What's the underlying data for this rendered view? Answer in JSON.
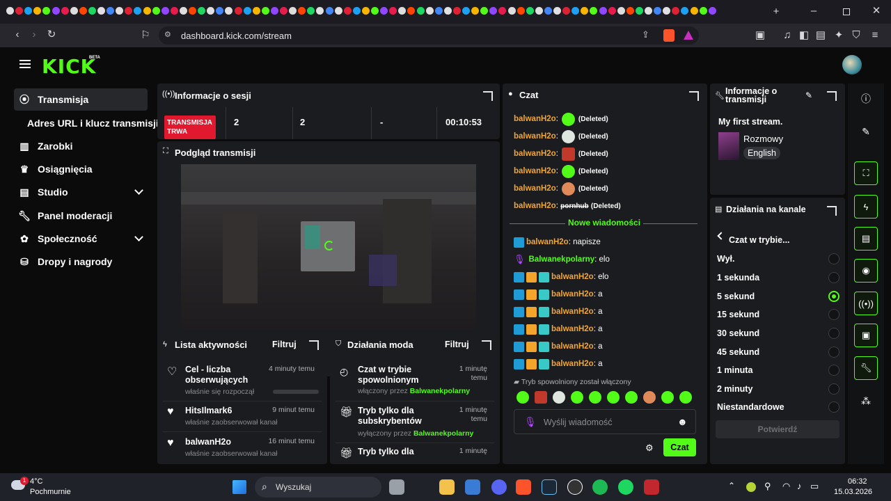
{
  "browser": {
    "url": "dashboard.kick.com/stream",
    "window_controls": [
      "minimize-icon",
      "maximize-icon",
      "close-icon"
    ]
  },
  "app": {
    "logo": "KICK",
    "logo_badge": "BETA",
    "accent": "#53fc18"
  },
  "sidebar": {
    "items": [
      {
        "label": "Transmisja",
        "icon": "broadcast-icon"
      },
      {
        "label": "Adres URL i klucz transmisji",
        "icon": ""
      },
      {
        "label": "Zarobki",
        "icon": "chart-icon"
      },
      {
        "label": "Osiągnięcia",
        "icon": "trophy-icon"
      },
      {
        "label": "Studio",
        "icon": "studio-icon"
      },
      {
        "label": "Panel moderacji",
        "icon": "wrench-icon"
      },
      {
        "label": "Społeczność",
        "icon": "community-icon"
      },
      {
        "label": "Dropy i nagrody",
        "icon": "drops-icon"
      }
    ]
  },
  "session": {
    "title": "Informacje o sesji",
    "live_badge_line1": "TRANSMISJA",
    "live_badge_line2": "TRWA",
    "stats": [
      "2",
      "2",
      "-",
      "00:10:53"
    ]
  },
  "preview": {
    "title": "Podgląd transmisji"
  },
  "activity": {
    "title": "Lista aktywności",
    "filter": "Filtruj",
    "rows": [
      {
        "title": "Cel - liczba obserwujących",
        "sub": "właśnie się rozpoczął",
        "time": "4 minuty temu"
      },
      {
        "title": "HitsIlmark6",
        "sub": "właśnie zaobserwował kanał",
        "time": "9 minut temu"
      },
      {
        "title": "balwanH2o",
        "sub": "właśnie zaobserwował kanał",
        "time": "16 minut temu"
      }
    ]
  },
  "modactions": {
    "title": "Działania moda",
    "filter": "Filtruj",
    "rows": [
      {
        "title": "Czat w trybie spowolnionym",
        "sub_prefix": "włączony przez",
        "user": "Balwanekpolarny",
        "time": "1 minutę temu"
      },
      {
        "title": "Tryb tylko dla subskrybentów",
        "sub_prefix": "wyłączony przez",
        "user": "Balwanekpolarny",
        "time": "1 minutę temu"
      },
      {
        "title": "Tryb tylko dla",
        "sub_prefix": "",
        "user": "",
        "time": "1 minutę"
      }
    ]
  },
  "chat": {
    "title": "Czat",
    "deleted_label": "(Deleted)",
    "deleted_user": "balwanH2o",
    "strike_text": "pornhub",
    "new_messages": "Nowe wiadomości",
    "messages": [
      {
        "user": "balwanH2o",
        "text": "napisze",
        "badges": [
          "mod"
        ]
      },
      {
        "user": "Balwanekpolarny",
        "text": "elo",
        "badges": [
          "mic"
        ]
      },
      {
        "user": "balwanH2o",
        "text": "elo",
        "badges": [
          "mod",
          "crown",
          "sub"
        ]
      },
      {
        "user": "balwanH2o",
        "text": "a",
        "badges": [
          "mod",
          "crown",
          "sub"
        ]
      },
      {
        "user": "balwanH2o",
        "text": "a",
        "badges": [
          "mod",
          "crown",
          "sub"
        ]
      },
      {
        "user": "balwanH2o",
        "text": "a",
        "badges": [
          "mod",
          "crown",
          "sub"
        ]
      },
      {
        "user": "balwanH2o",
        "text": "a",
        "badges": [
          "mod",
          "crown",
          "sub"
        ]
      },
      {
        "user": "balwanH2o",
        "text": "a",
        "badges": [
          "mod",
          "crown",
          "sub"
        ]
      }
    ],
    "slow_notice": "Tryb spowolniony został włączony",
    "input_placeholder": "Wyślij wiadomość",
    "send_label": "Czat"
  },
  "stream_info": {
    "title": "Informacje o transmisji",
    "stream_title": "My first stream.",
    "category": "Rozmowy",
    "language": "English"
  },
  "channel_actions": {
    "title": "Działania na kanale",
    "back_label": "Czat w trybie...",
    "options": [
      "Wył.",
      "1 sekunda",
      "5 sekund",
      "15 sekund",
      "30 sekund",
      "45 sekund",
      "1 minuta",
      "2 minuty",
      "Niestandardowe"
    ],
    "selected": "5 sekund",
    "confirm": "Potwierdź"
  },
  "taskbar": {
    "weather_temp": "4°C",
    "weather_desc": "Pochmurnie",
    "search": "Wyszukaj",
    "time": "06:32",
    "date": "15.03.2026"
  }
}
